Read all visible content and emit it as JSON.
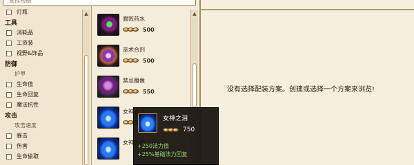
{
  "search": {
    "placeholder": "查找物品"
  },
  "filters": [
    {
      "type": "item",
      "label": "灯瓶"
    },
    {
      "type": "cat",
      "label": "工具"
    },
    {
      "type": "item",
      "label": "消耗品"
    },
    {
      "type": "item",
      "label": "工资装"
    },
    {
      "type": "item",
      "label": "视野&饰品"
    },
    {
      "type": "cat",
      "label": "防御"
    },
    {
      "type": "sub",
      "label": "护甲"
    },
    {
      "type": "item",
      "label": "生命值"
    },
    {
      "type": "item",
      "label": "生命回复"
    },
    {
      "type": "item",
      "label": "魔法抗性"
    },
    {
      "type": "cat",
      "label": "攻击"
    },
    {
      "type": "sub",
      "label": "攻击速度"
    },
    {
      "type": "item",
      "label": "暴击"
    },
    {
      "type": "item",
      "label": "伤害"
    },
    {
      "type": "item",
      "label": "生命偷取"
    }
  ],
  "items": [
    {
      "name": "腐败药水",
      "price": "500",
      "icon": "corrupting-potion"
    },
    {
      "name": "巫术合剂",
      "price": "500",
      "icon": "elixir-of-sorcery"
    },
    {
      "name": "禁忌雕像",
      "price": "550",
      "icon": "forbidden-idol"
    },
    {
      "name": "女神之泪",
      "price": "750",
      "icon": "tear-of-the-goddess"
    },
    {
      "name": "女神之泪",
      "price": "",
      "icon": "tear-of-the-goddess"
    }
  ],
  "main": {
    "empty_message": "没有选择配装方案。创建或选择一个方案来浏览!"
  },
  "tooltip": {
    "name": "女神之泪",
    "price": "750",
    "stats": [
      "+250法力值",
      "+25%基础法力回复"
    ]
  },
  "colors": {
    "stat_green": "#8fde6e",
    "panel_bg": "#f4ecd9",
    "border_gold": "#b59c6d"
  }
}
